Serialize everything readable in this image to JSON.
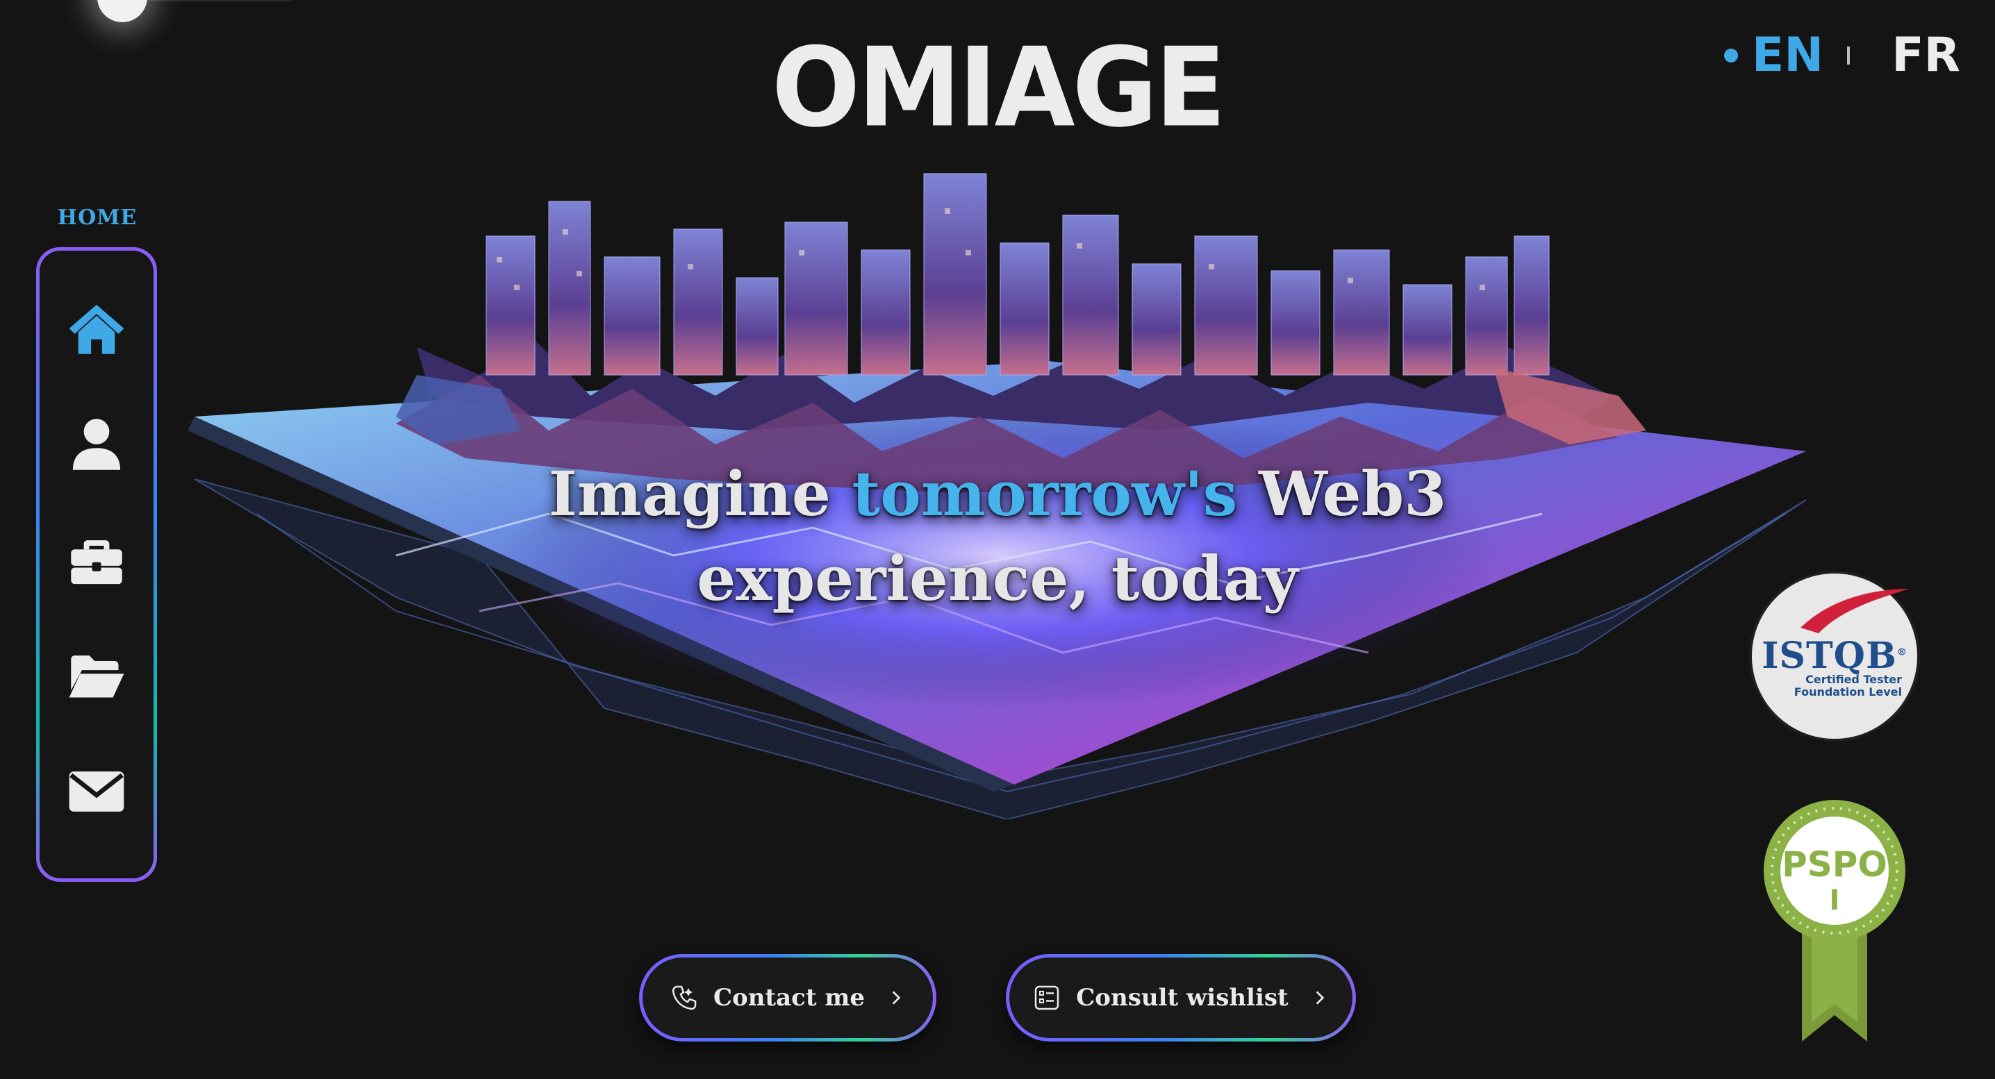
{
  "header": {
    "logo_text": "OMIAGE",
    "languages": [
      {
        "code": "EN",
        "active": true
      },
      {
        "code": "FR",
        "active": false
      }
    ],
    "accent_color": "#3ea9e6"
  },
  "sidebar": {
    "active_label": "HOME",
    "items": [
      {
        "icon": "home-icon",
        "active": true
      },
      {
        "icon": "user-icon",
        "active": false
      },
      {
        "icon": "briefcase-icon",
        "active": false
      },
      {
        "icon": "folder-open-icon",
        "active": false
      },
      {
        "icon": "envelope-icon",
        "active": false
      }
    ]
  },
  "hero": {
    "headline_part1": "Imagine ",
    "headline_accent": "tomorrow's",
    "headline_part2": " Web3",
    "headline_line2": "experience, today",
    "image": "low-poly-floating-city-island"
  },
  "badges": {
    "istqb": {
      "title": "ISTQB",
      "registered": "®",
      "line1": "Certified Tester",
      "line2": "Foundation Level"
    },
    "pspo": {
      "line1": "PSPO",
      "line2": "I"
    }
  },
  "actions": {
    "contact_label": "Contact me",
    "wishlist_label": "Consult wishlist"
  }
}
